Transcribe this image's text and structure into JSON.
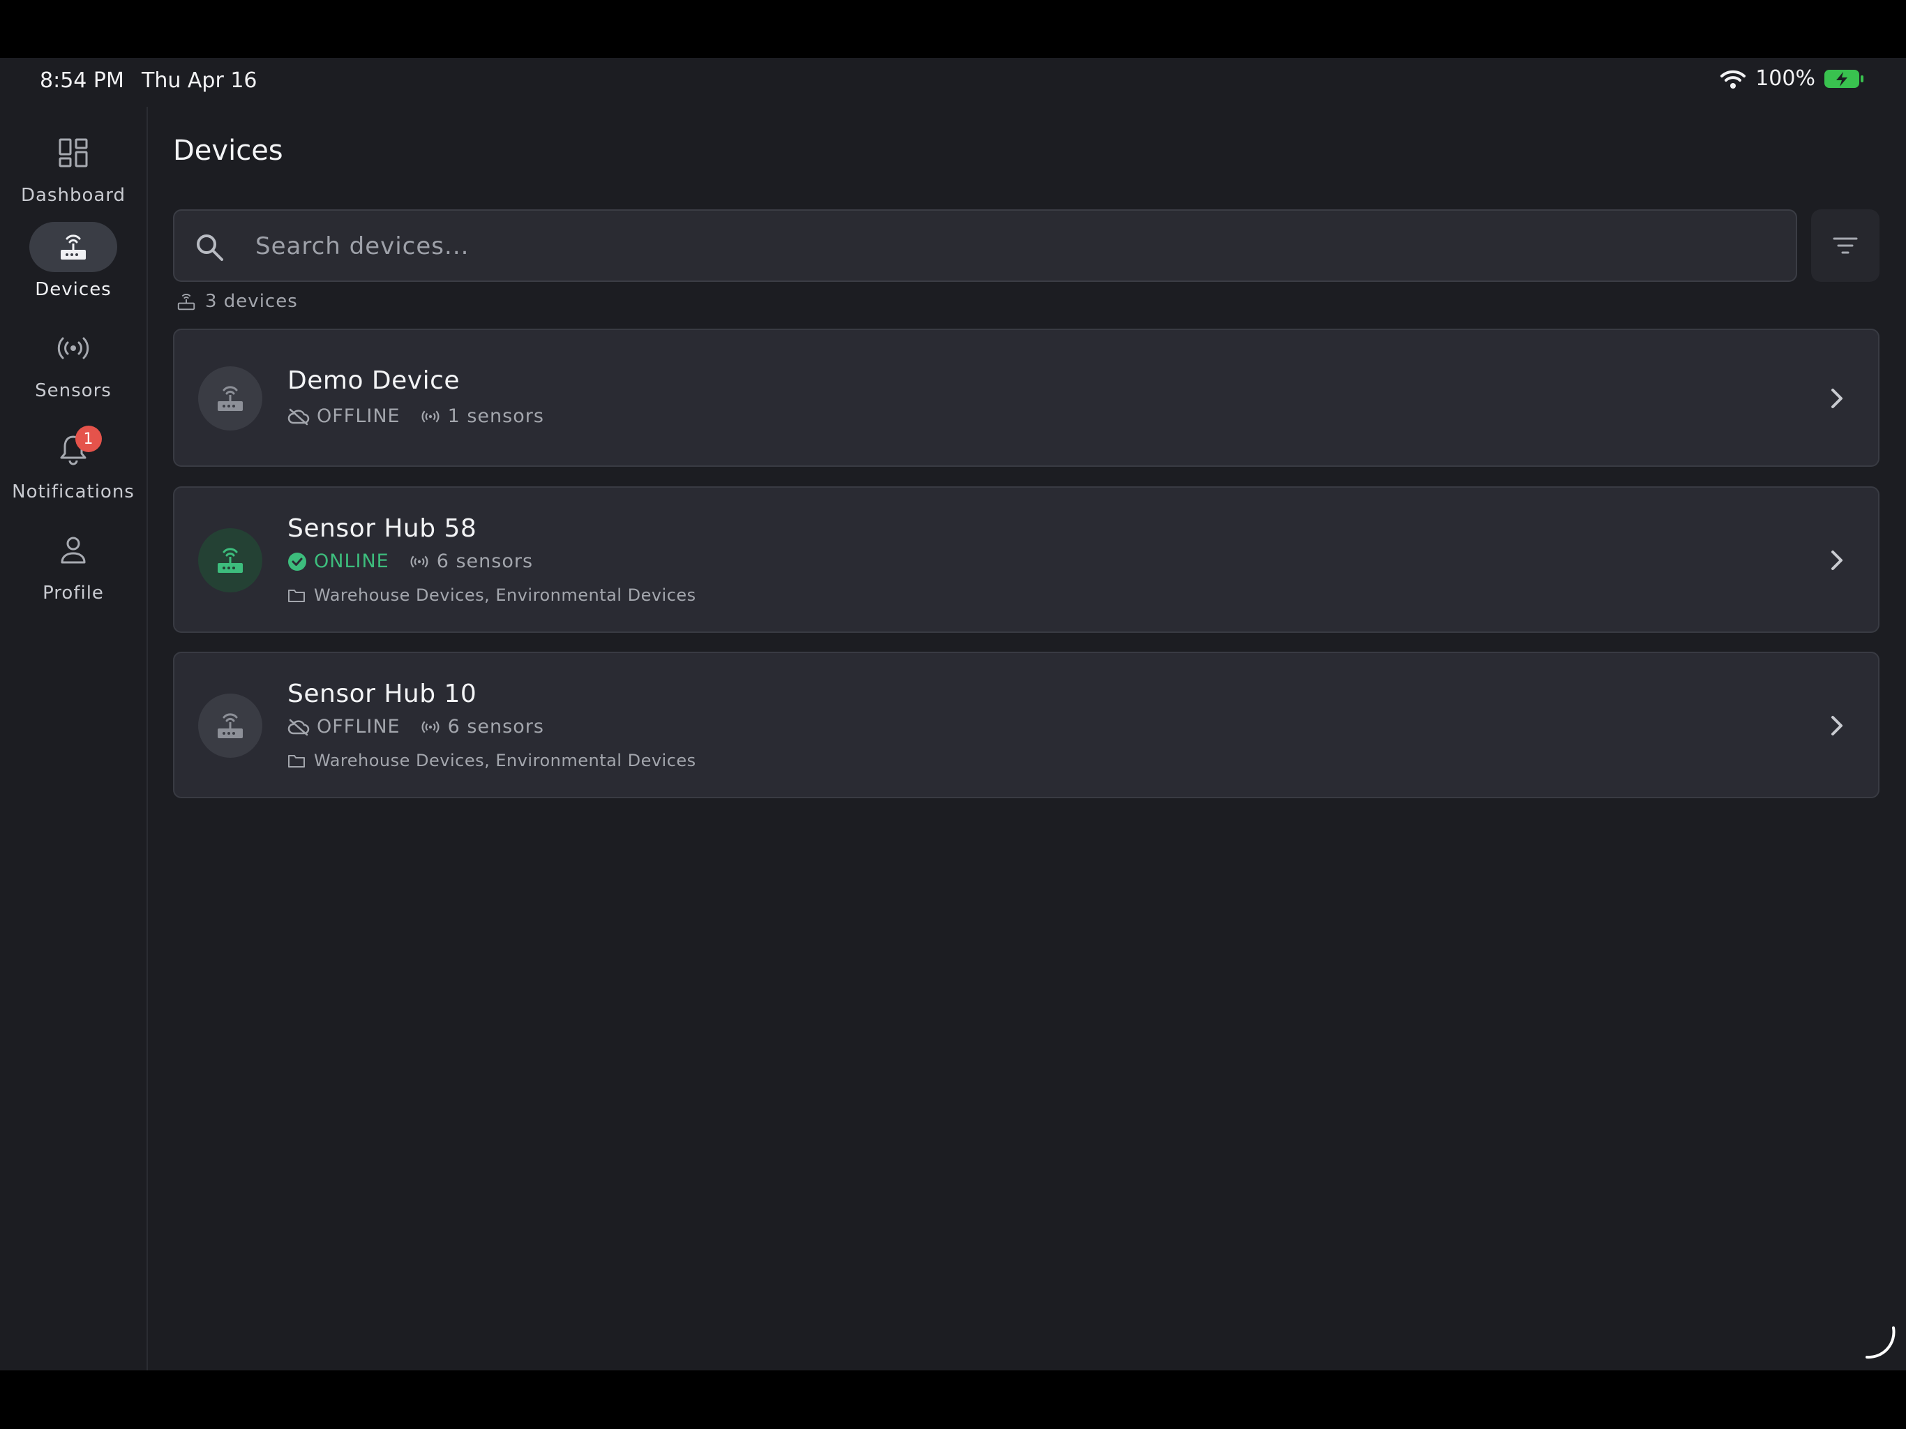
{
  "status_bar": {
    "time": "8:54 PM",
    "date": "Thu Apr 16",
    "battery": "100%"
  },
  "sidebar": {
    "items": [
      {
        "label": "Dashboard",
        "icon": "dashboard-icon"
      },
      {
        "label": "Devices",
        "icon": "router-icon",
        "active": true
      },
      {
        "label": "Sensors",
        "icon": "sensors-icon"
      },
      {
        "label": "Notifications",
        "icon": "bell-icon",
        "badge": "1"
      },
      {
        "label": "Profile",
        "icon": "person-icon"
      }
    ]
  },
  "page": {
    "title": "Devices"
  },
  "search": {
    "placeholder": "Search devices..."
  },
  "device_count": "3 devices",
  "devices": [
    {
      "name": "Demo Device",
      "status": "OFFLINE",
      "sensors": "1 sensors",
      "groups": ""
    },
    {
      "name": "Sensor Hub 58",
      "status": "ONLINE",
      "sensors": "6 sensors",
      "groups": "Warehouse Devices, Environmental Devices"
    },
    {
      "name": "Sensor Hub 10",
      "status": "OFFLINE",
      "sensors": "6 sensors",
      "groups": "Warehouse Devices, Environmental Devices"
    }
  ],
  "colors": {
    "background": "#1c1d22",
    "card": "#2a2b33",
    "online": "#3dbd7d",
    "badge": "#e5534b",
    "battery": "#39c24f"
  }
}
